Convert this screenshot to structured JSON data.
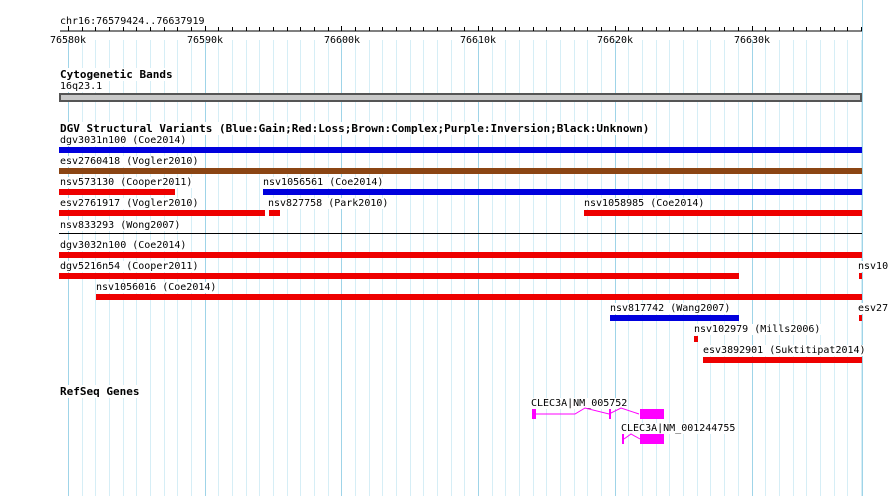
{
  "ruler": {
    "locus": "chr16:76579424..76637919",
    "ticks": [
      "76580k",
      "76590k",
      "76600k",
      "76610k",
      "76620k",
      "76630k"
    ]
  },
  "cytobands": {
    "title": "Cytogenetic Bands",
    "band": "16q23.1"
  },
  "dgv": {
    "title": "DGV Structural Variants (Blue:Gain;Red:Loss;Brown:Complex;Purple:Inversion;Black:Unknown)",
    "variants": [
      {
        "label": "dgv3031n100 (Coe2014)",
        "color": "#0000dd"
      },
      {
        "label": "esv2760418 (Vogler2010)",
        "color": "#8b4513"
      },
      {
        "label": "nsv573130 (Cooper2011)",
        "color": "#ee0000"
      },
      {
        "label": "nsv1056561 (Coe2014)",
        "color": "#0000dd"
      },
      {
        "label": "esv2761917 (Vogler2010)",
        "color": "#ee0000"
      },
      {
        "label": "nsv827758 (Park2010)",
        "color": "#ee0000"
      },
      {
        "label": "nsv1058985 (Coe2014)",
        "color": "#ee0000"
      },
      {
        "label": "nsv833293 (Wong2007)",
        "color": "#000000"
      },
      {
        "label": "dgv3032n100 (Coe2014)",
        "color": "#ee0000"
      },
      {
        "label": "dgv5216n54 (Cooper2011)",
        "color": "#ee0000"
      },
      {
        "label": "nsv10(",
        "color": "#ee0000"
      },
      {
        "label": "nsv1056016 (Coe2014)",
        "color": "#ee0000"
      },
      {
        "label": "nsv817742 (Wang2007)",
        "color": "#0000dd"
      },
      {
        "label": "esv27(",
        "color": "#ee0000"
      },
      {
        "label": "nsv102979 (Mills2006)",
        "color": "#ee0000"
      },
      {
        "label": "esv3892901 (Suktitipat2014)",
        "color": "#ee0000"
      }
    ]
  },
  "refseq": {
    "title": "RefSeq Genes",
    "transcripts": [
      {
        "label": "CLEC3A|NM_005752",
        "color": "#ff00ff"
      },
      {
        "label": "CLEC3A|NM_001244755",
        "color": "#ff00ff"
      }
    ]
  }
}
